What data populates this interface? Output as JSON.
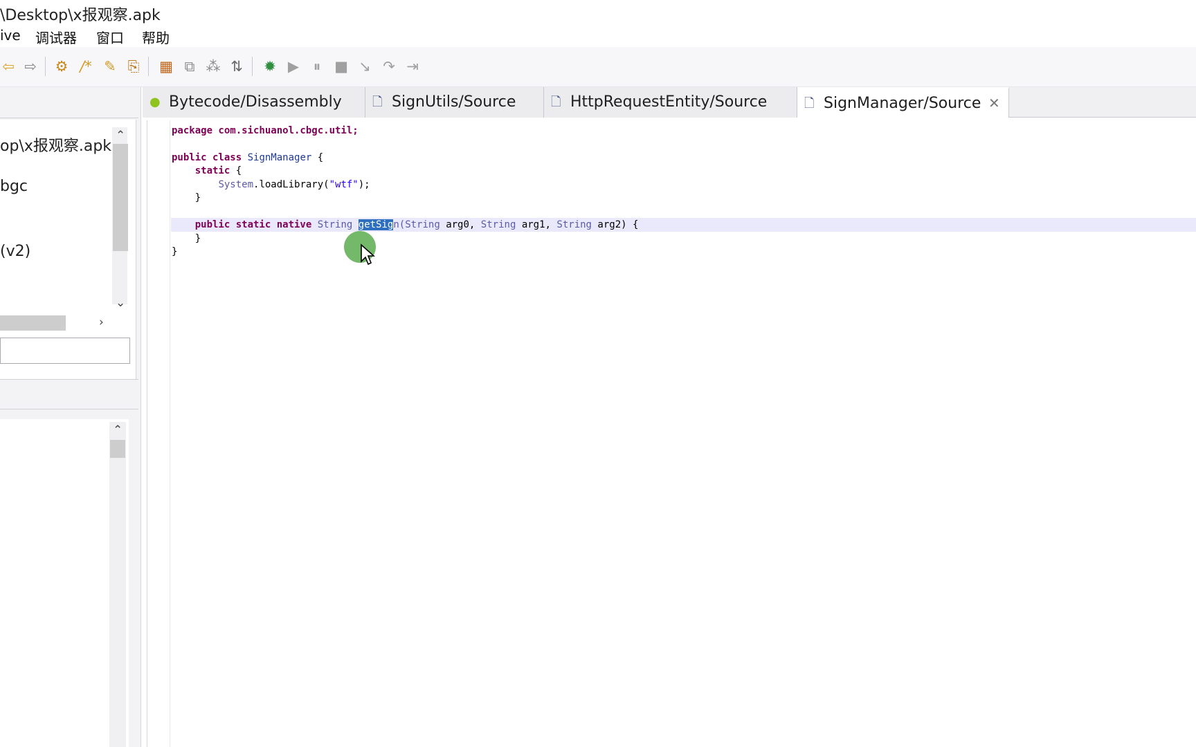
{
  "window": {
    "title": "\\Desktop\\x报观察.apk"
  },
  "menu": {
    "items": [
      {
        "label": "ive"
      },
      {
        "label": "调试器"
      },
      {
        "label": "窗口"
      },
      {
        "label": "帮助"
      }
    ]
  },
  "toolbar": {
    "icons": [
      "back-arrow-icon",
      "forward-arrow-icon",
      "decompile-icon",
      "comment-icon",
      "rename-icon",
      "navigate-icon",
      "structure-icon",
      "hierarchy-icon",
      "graph-icon",
      "sort-icon",
      "debug-icon",
      "resume-icon",
      "pause-icon",
      "stop-icon",
      "step-into-icon",
      "step-over-icon",
      "step-out-icon"
    ]
  },
  "project_tree": {
    "items": [
      {
        "label": "op\\x报观察.apk"
      },
      {
        "label": "bgc"
      },
      {
        "label": "(v2)"
      }
    ]
  },
  "filter": {
    "value": "",
    "placeholder": ""
  },
  "editor_tabs": [
    {
      "label": "Bytecode/Disassembly",
      "icon": "android-icon"
    },
    {
      "label": "SignUtils/Source",
      "icon": "source-file-icon"
    },
    {
      "label": "HttpRequestEntity/Source",
      "icon": "source-file-icon"
    },
    {
      "label": "SignManager/Source",
      "icon": "source-file-icon",
      "active": true
    }
  ],
  "code": {
    "line1": "package com.sichuanol.cbgc.util;",
    "line3_kw": "public class",
    "line3_cls": "SignManager",
    "line3_end": "{",
    "line4_kw": "static",
    "line4_end": "{",
    "line5_cls": "System",
    "line5_mid": ".loadLibrary(",
    "line5_str": "\"wtf\"",
    "line5_end": ");",
    "line6": "}",
    "line8_kw": "public static native",
    "line8_type1": "String",
    "line8_sel": "getSig",
    "line8_after_sel": "n(",
    "line8_type2": "String",
    "line8_arg0": "arg0,",
    "line8_type3": "String",
    "line8_arg1": "arg1,",
    "line8_type4": "String",
    "line8_arg2": "arg2) {",
    "line9": "}",
    "line10": "}"
  },
  "colors": {
    "keyword": "#7f0055",
    "type": "#5a5aa8",
    "string": "#2a00ff",
    "selection": "#2f6fc0",
    "current_line": "#e9e9fb",
    "cursor_halo": "#56a848"
  }
}
